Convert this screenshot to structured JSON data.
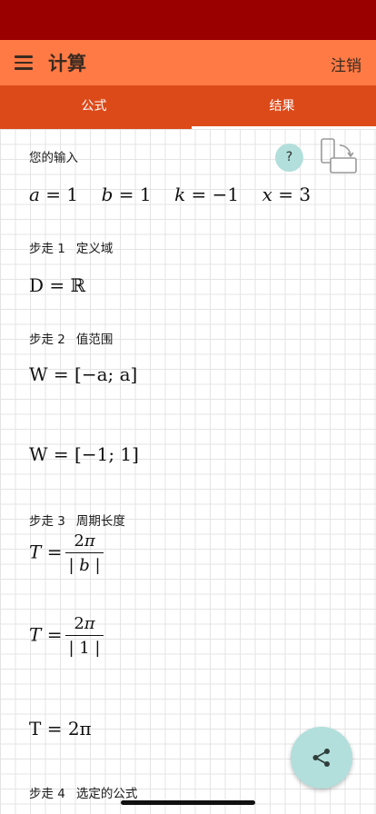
{
  "app": {
    "title": "计算",
    "logout_label": "注销"
  },
  "tabs": [
    {
      "label": "公式",
      "selected": false
    },
    {
      "label": "结果",
      "selected": true
    }
  ],
  "input": {
    "label": "您的输入",
    "help_label": "?",
    "a": "1",
    "b": "1",
    "k": "−1",
    "x": "3"
  },
  "steps": [
    {
      "label": "步走 1",
      "title": "定义域",
      "formulas": [
        "D = ℝ"
      ]
    },
    {
      "label": "步走 2",
      "title": "值范围",
      "formulas": [
        "W = [−a; a]",
        "W = [−1; 1]"
      ]
    },
    {
      "label": "步走 3",
      "title": "周期长度",
      "formulas": [
        "T = 2π / | b |",
        "T = 2π / | 1 |",
        "T = 2π"
      ]
    },
    {
      "label": "步走 4",
      "title": "选定的公式",
      "formulas": []
    }
  ],
  "icons": {
    "menu": "hamburger-menu-icon",
    "rotate": "rotate-screen-icon",
    "share": "share-icon"
  },
  "colors": {
    "status_bar": "#9b0000",
    "app_bar": "#ff7a45",
    "tab_bar": "#dd4a1a",
    "fab": "#b2dfdb"
  }
}
